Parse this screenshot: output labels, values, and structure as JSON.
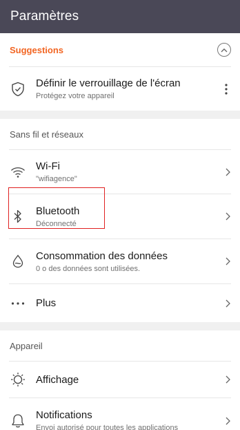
{
  "app_bar": {
    "title": "Paramètres"
  },
  "suggestions": {
    "header": "Suggestions",
    "item": {
      "title": "Définir le verrouillage de l'écran",
      "subtitle": "Protégez votre appareil",
      "icon": "shield-check-icon"
    }
  },
  "wireless": {
    "header": "Sans fil et réseaux",
    "items": [
      {
        "title": "Wi-Fi",
        "subtitle": "\"wifiagence\"",
        "icon": "wifi-icon"
      },
      {
        "title": "Bluetooth",
        "subtitle": "Déconnecté",
        "icon": "bluetooth-icon"
      },
      {
        "title": "Consommation des données",
        "subtitle": "0 o des données sont utilisées.",
        "icon": "data-drop-icon"
      },
      {
        "title": "Plus",
        "icon": "more-horizontal-icon"
      }
    ]
  },
  "device": {
    "header": "Appareil",
    "items": [
      {
        "title": "Affichage",
        "icon": "brightness-icon"
      },
      {
        "title": "Notifications",
        "subtitle": "Envoi autorisé pour toutes les applications",
        "icon": "bell-icon"
      }
    ]
  },
  "colors": {
    "app_bar": "#4a4857",
    "accent": "#f26522",
    "highlight": "#e02020"
  }
}
